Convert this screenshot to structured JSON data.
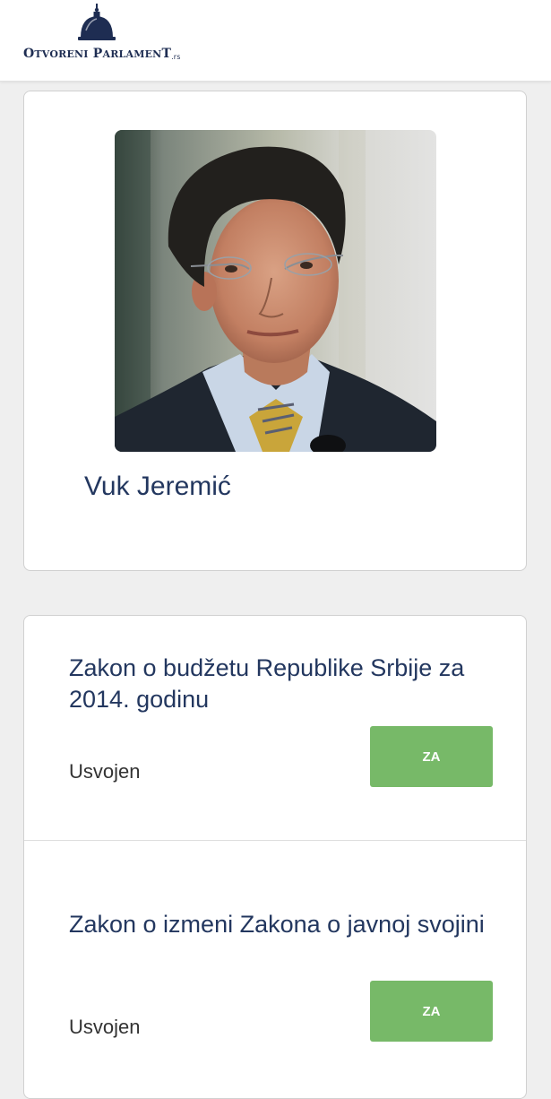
{
  "header": {
    "logo": {
      "word1_cap": "O",
      "word1_rest": "TVORENI",
      "word2_cap": "P",
      "word2_rest": "ARLAMEN",
      "word2_end": "T",
      "tld": ".rs",
      "icon": "parliament-dome-icon"
    }
  },
  "profile": {
    "name": "Vuk Jeremić",
    "photo": "portrait-photo"
  },
  "votes": [
    {
      "title": "Zakon o budžetu Republike Srbije za 2014. godinu",
      "status": "Usvojen",
      "vote_label": "ZA"
    },
    {
      "title": "Zakon o izmeni Zakona o javnoj svojini",
      "status": "Usvojen",
      "vote_label": "ZA"
    }
  ],
  "colors": {
    "brand": "#1e2d52",
    "accent_text": "#23375f",
    "vote_yes": "#77b968",
    "background": "#efefef"
  }
}
